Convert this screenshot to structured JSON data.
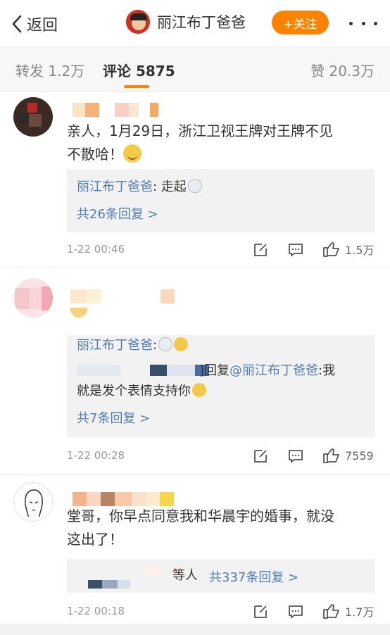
{
  "nav": {
    "back_label": "返回",
    "title": "丽江布丁爸爸",
    "follow_label": "+关注"
  },
  "tabs": {
    "repost": "转发 1.2万",
    "comments": "评论 5875",
    "likes": "赞 20.3万"
  },
  "comments": [
    {
      "text_line1": "亲人，1月29日，浙江卫视王牌对王牌不见",
      "text_line2": "不散哈！",
      "reply_author": "丽江布丁爸爸",
      "reply_text": ": 走起",
      "more_replies": "共26条回复 >",
      "time": "1-22 00:46",
      "likes": "1.5万"
    },
    {
      "reply1_author": "丽江布丁爸爸",
      "reply1_text": ":",
      "reply2_prefix": "]回复",
      "reply2_mention": "@丽江布丁爸爸",
      "reply2_text": ":我",
      "reply2_line2": "就是发个表情支持你",
      "more_replies": "共7条回复 >",
      "time": "1-22 00:28",
      "likes": "7559"
    },
    {
      "text_line1": "堂哥，你早点同意我和华晨宇的婚事，就没",
      "text_line2": "这出了！",
      "reply_suffix": "等人",
      "more_replies": "共337条回复 >",
      "time": "1-22 00:18",
      "likes": "1.7万"
    }
  ],
  "colors": {
    "accent": "#ff8200",
    "link": "#507daf",
    "reply_bg": "#f2f2f2"
  }
}
